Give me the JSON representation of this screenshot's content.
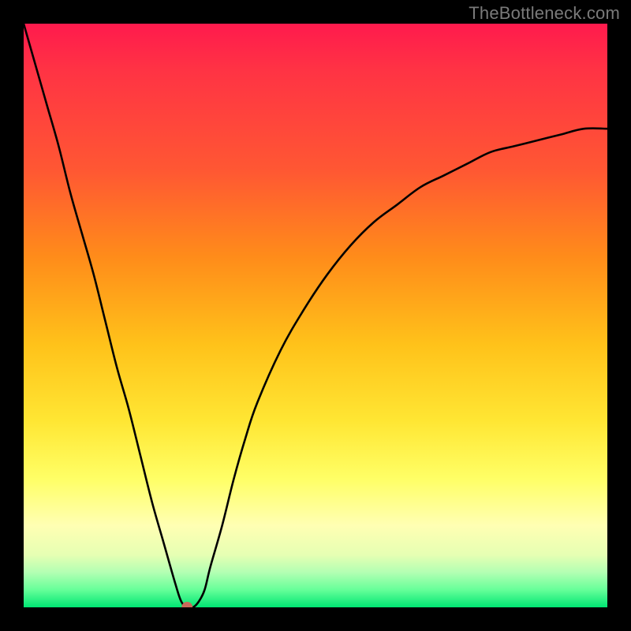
{
  "watermark": "TheBottleneck.com",
  "chart_data": {
    "type": "line",
    "title": "",
    "xlabel": "",
    "ylabel": "",
    "xlim": [
      0,
      100
    ],
    "ylim": [
      0,
      100
    ],
    "grid": false,
    "background_gradient": {
      "top_color": "#ff1a4d",
      "bottom_color": "#00e673",
      "stops": [
        "red",
        "orange",
        "yellow",
        "green"
      ]
    },
    "series": [
      {
        "name": "bottleneck-curve",
        "color": "#000000",
        "x": [
          0,
          2,
          4,
          6,
          8,
          10,
          12,
          14,
          16,
          18,
          20,
          22,
          24,
          26,
          27,
          28,
          29,
          30,
          31,
          32,
          34,
          36,
          38,
          40,
          44,
          48,
          52,
          56,
          60,
          64,
          68,
          72,
          76,
          80,
          84,
          88,
          92,
          96,
          100
        ],
        "values": [
          100,
          93,
          86,
          79,
          71,
          64,
          57,
          49,
          41,
          34,
          26,
          18,
          11,
          4,
          1,
          0,
          0,
          1,
          3,
          7,
          14,
          22,
          29,
          35,
          44,
          51,
          57,
          62,
          66,
          69,
          72,
          74,
          76,
          78,
          79,
          80,
          81,
          82,
          82
        ]
      }
    ],
    "marker": {
      "name": "optimal-point",
      "x": 28,
      "y": 0,
      "color": "#c86a5a",
      "radius_px": 7
    }
  },
  "colors": {
    "frame": "#000000",
    "curve": "#000000",
    "marker": "#c86a5a"
  }
}
